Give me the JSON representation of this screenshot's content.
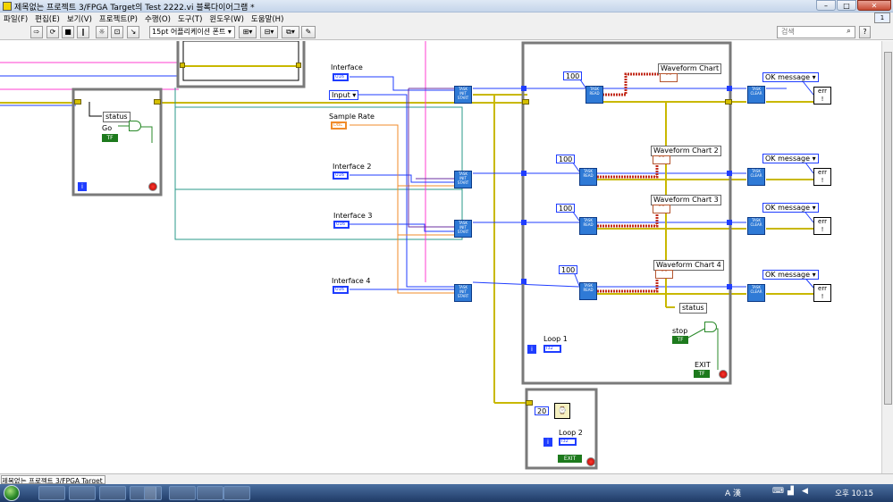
{
  "window": {
    "title": "제목없는 프로젝트 3/FPGA Target의 Test 2222.vi 블록다이어그램 *",
    "minimize": "–",
    "maximize": "□",
    "close": "✕"
  },
  "menu": {
    "items": [
      "파일(F)",
      "편집(E)",
      "보기(V)",
      "프로젝트(P)",
      "수행(O)",
      "도구(T)",
      "윈도우(W)",
      "도움말(H)"
    ]
  },
  "toolbar": {
    "font": "15pt 어플리케이션 폰트",
    "search_placeholder": "검색",
    "help": "?"
  },
  "diagram": {
    "labels": {
      "status_top": "status",
      "go": "Go",
      "interface": "Interface",
      "input": "Input",
      "sample_rate": "Sample Rate",
      "interface2": "Interface 2",
      "interface3": "Interface 3",
      "interface4": "Interface 4",
      "waveform_chart": "Waveform Chart",
      "waveform_chart2": "Waveform Chart 2",
      "waveform_chart3": "Waveform Chart 3",
      "waveform_chart4": "Waveform Chart 4",
      "status_bottom": "status",
      "stop": "stop",
      "exit": "EXIT",
      "loop1": "Loop 1",
      "loop2": "Loop 2",
      "exit2": "EXIT"
    },
    "constants": {
      "c1": "100",
      "c2": "100",
      "c3": "100",
      "c4": "100",
      "wait_ms": "20"
    },
    "ok_messages": [
      "OK message",
      "OK message",
      "OK message",
      "OK message"
    ],
    "terminals": {
      "u16": "U16",
      "dbl": "DBL",
      "i32": "I32",
      "tf": "TF",
      "i": "i"
    },
    "node_text": {
      "task_start": "TASK INIT START",
      "read": "TASK READ",
      "clear": "TASK CLEAR"
    }
  },
  "statusbar": {
    "path": "제목없는 프로젝트 3/FPGA Target"
  },
  "taskbar": {
    "clock": "오후 10:15",
    "ime": "A 漢"
  },
  "colors": {
    "wire_blue": "#1f3dff",
    "wire_pink": "#ff3fd0",
    "wire_teal": "#2a9a8a",
    "wire_yellow": "#c9b800",
    "wire_orange": "#f08b2a",
    "wire_red": "#c22a1a",
    "wire_green": "#2a8a2a",
    "loop_border": "#7a7a7a"
  }
}
